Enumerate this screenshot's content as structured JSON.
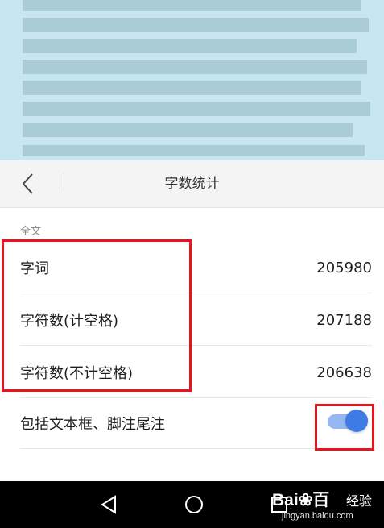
{
  "header": {
    "title": "字数统计",
    "back_icon": "chevron-left-icon"
  },
  "section": {
    "label": "全文"
  },
  "stats": [
    {
      "label": "字词",
      "value": "205980"
    },
    {
      "label": "字符数(计空格)",
      "value": "207188"
    },
    {
      "label": "字符数(不计空格)",
      "value": "206638"
    }
  ],
  "options": {
    "include_textbox_label": "包括文本框、脚注尾注",
    "include_textbox_enabled": true
  },
  "navbar": {
    "back_icon": "triangle-back-icon",
    "home_icon": "circle-home-icon",
    "recents_icon": "square-recents-icon"
  },
  "watermark": {
    "brand": "Bai",
    "brand_suffix": "百",
    "product": "经验",
    "url": "jingyan.baidu.com"
  },
  "colors": {
    "accent": "#3f7be6",
    "annotation": "#e8141c",
    "document_background": "#c7e6ef"
  }
}
